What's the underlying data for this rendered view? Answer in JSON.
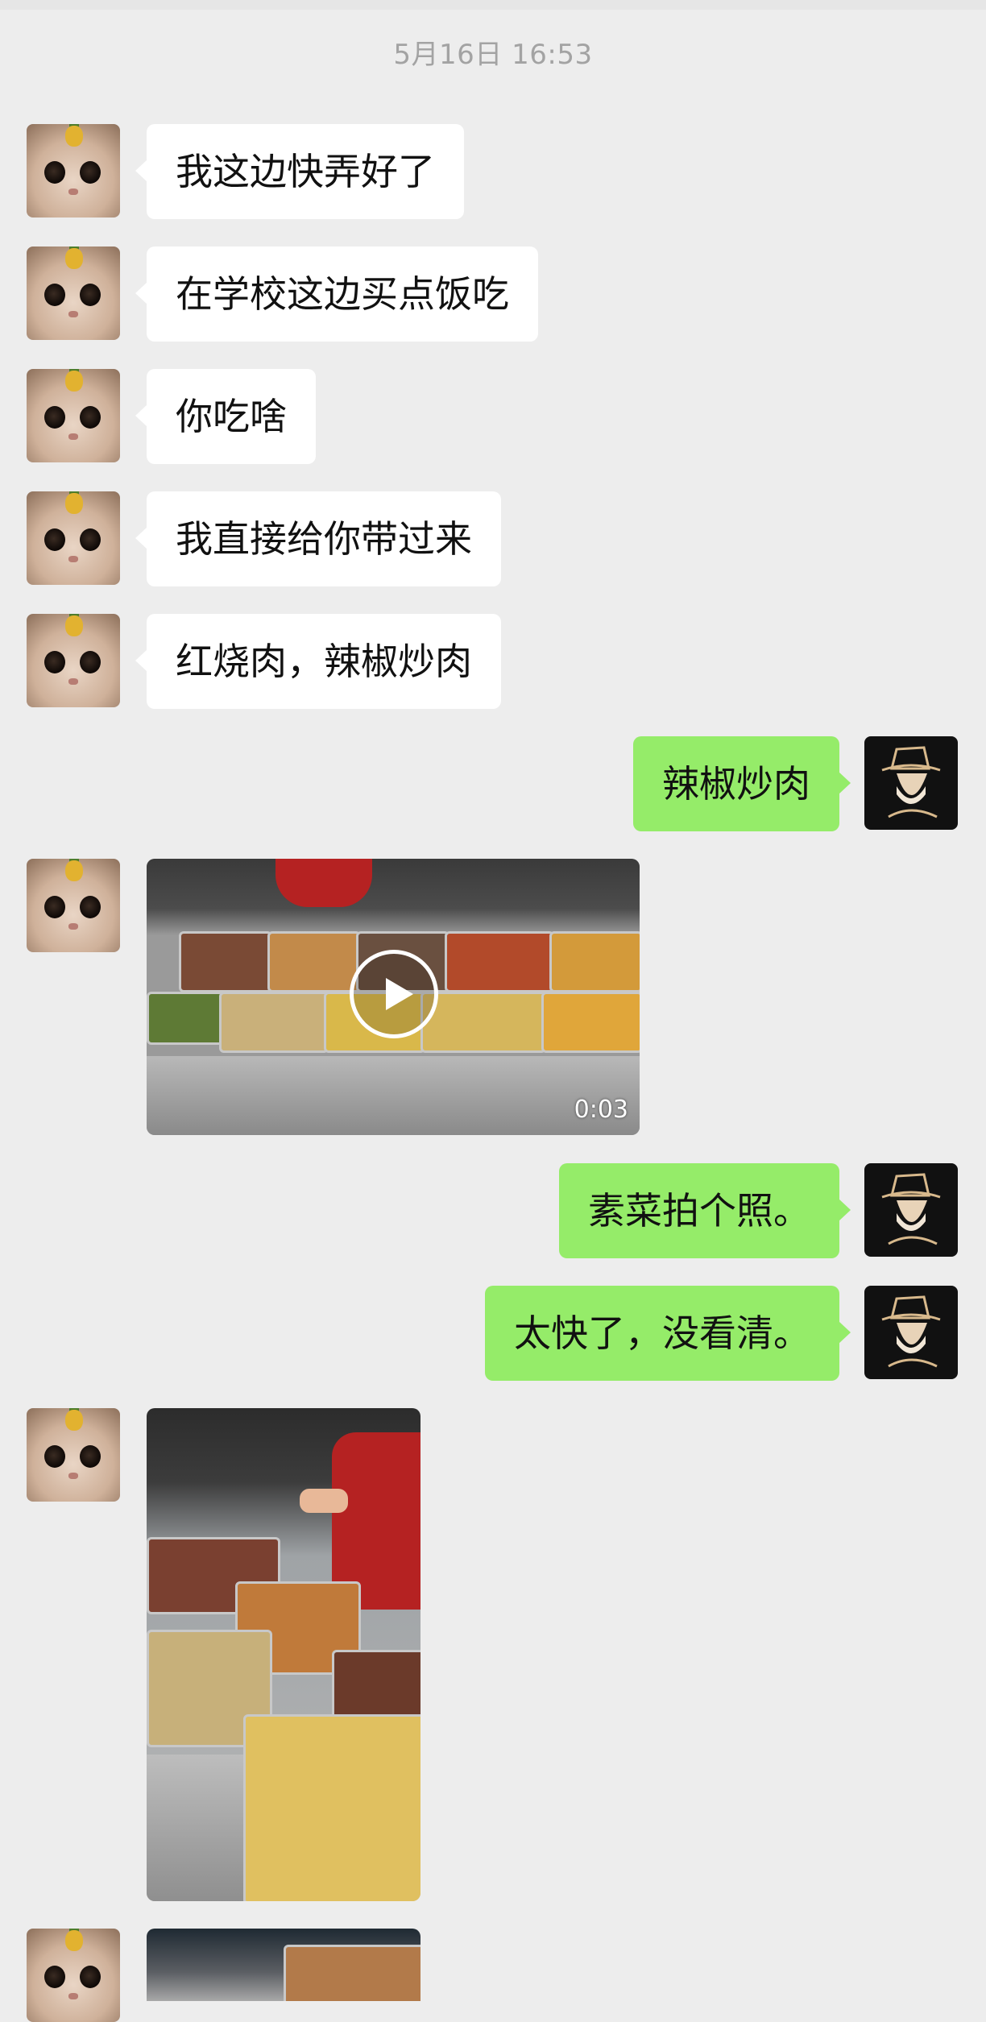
{
  "timestamp": "5月16日 16:53",
  "messages": [
    {
      "side": "in",
      "type": "text",
      "text": "我这边快弄好了"
    },
    {
      "side": "in",
      "type": "text",
      "text": "在学校这边买点饭吃"
    },
    {
      "side": "in",
      "type": "text",
      "text": "你吃啥"
    },
    {
      "side": "in",
      "type": "text",
      "text": "我直接给你带过来"
    },
    {
      "side": "in",
      "type": "text",
      "text": "红烧肉，辣椒炒肉"
    },
    {
      "side": "out",
      "type": "text",
      "text": "辣椒炒肉"
    },
    {
      "side": "in",
      "type": "video",
      "duration": "0:03"
    },
    {
      "side": "out",
      "type": "text",
      "text": "素菜拍个照。"
    },
    {
      "side": "out",
      "type": "text",
      "text": "太快了，没看清。"
    },
    {
      "side": "in",
      "type": "image"
    },
    {
      "side": "in",
      "type": "image"
    }
  ],
  "colors": {
    "background": "#ededed",
    "incoming_bubble": "#ffffff",
    "outgoing_bubble": "#95ec69",
    "timestamp": "#a3a3a3"
  },
  "icons": {
    "contact_avatar": "cat-avatar-icon",
    "self_avatar": "hat-avatar-icon",
    "video_play": "play-icon"
  }
}
